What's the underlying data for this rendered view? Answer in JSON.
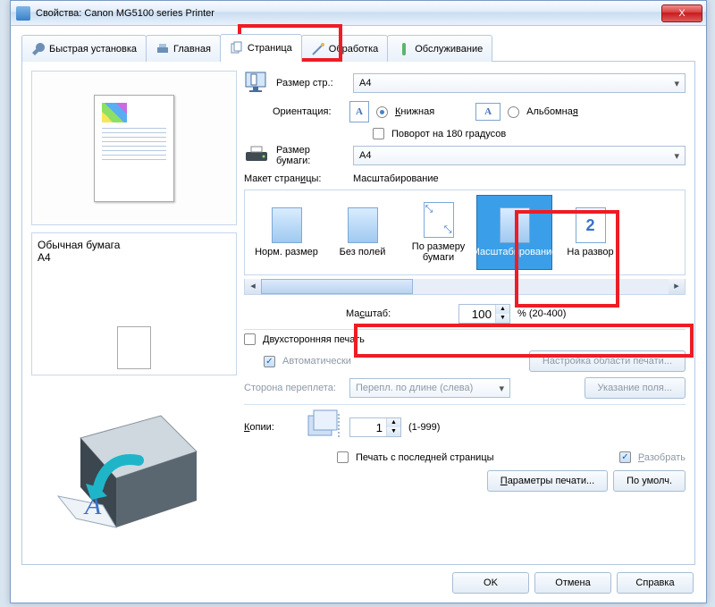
{
  "window": {
    "title": "Свойства: Canon MG5100 series Printer",
    "close": "X"
  },
  "tabs": {
    "quick": "Быстрая установка",
    "main": "Главная",
    "page": "Страница",
    "effects": "Обработка",
    "maint": "Обслуживание"
  },
  "left_info": {
    "paper": "Обычная бумага",
    "size": "A4"
  },
  "labels": {
    "page_size": "Размер стр.:",
    "orientation": "Ориентация:",
    "portrait": "Книжная",
    "landscape": "Альбомная",
    "rotate180": "Поворот на 180 градусов",
    "paper_size": "Размер бумаги:",
    "layout": "Макет страницы:",
    "layout_val": "Масштабирование",
    "scale": "Масштаб:",
    "scale_suffix": "% (20-400)",
    "duplex": "Двухсторонняя печать",
    "auto": "Автоматически",
    "area_btn": "Настройка области печати...",
    "bind_side": "Сторона переплета:",
    "bind_val": "Перепл. по длине (слева)",
    "margin_btn": "Указание поля...",
    "copies": "Копии:",
    "copies_range": "(1-999)",
    "from_last": "Печать с последней страницы",
    "collate": "Разобрать",
    "print_params": "Параметры печати...",
    "defaults": "По умолч."
  },
  "values": {
    "page_size": "A4",
    "paper_size": "A4",
    "scale": "100",
    "copies": "1"
  },
  "layout_items": {
    "normal": "Норм. размер",
    "borderless": "Без полей",
    "fit": "По размеру бумаги",
    "scaled": "Масштабирование",
    "poster": "На развор"
  },
  "dlg": {
    "ok": "OK",
    "cancel": "Отмена",
    "help": "Справка"
  },
  "icons": {
    "printer": "printer",
    "monitor": "monitor"
  }
}
